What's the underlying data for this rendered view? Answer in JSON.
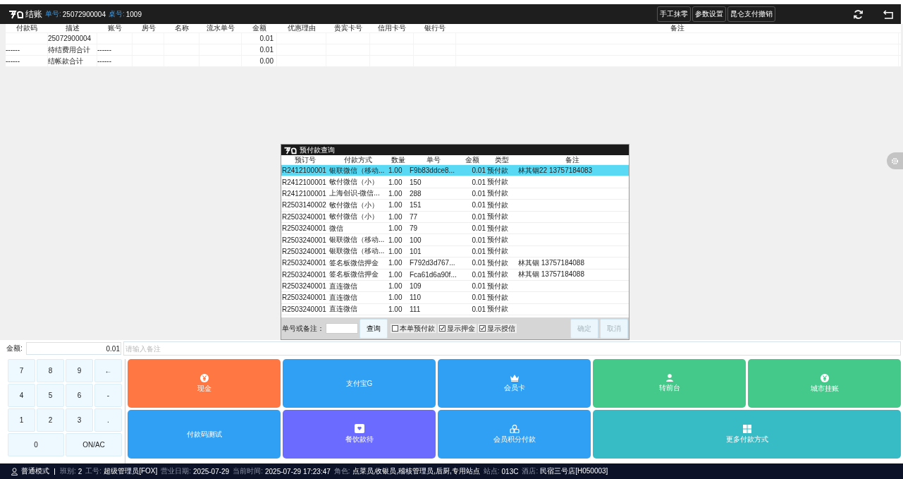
{
  "header": {
    "title": "结账",
    "order_label": "单号:",
    "order_no": "25072900004",
    "table_label": "桌号:",
    "table_no": "1009",
    "buttons": [
      "手工抹零",
      "参数设置",
      "昆仑支付撤销"
    ]
  },
  "bill_table": {
    "columns": [
      "付款码",
      "描述",
      "账号",
      "房号",
      "名称",
      "流水单号",
      "金额",
      "优惠理由",
      "贵宾卡号",
      "信用卡号",
      "银行号",
      "备注"
    ],
    "rows": [
      {
        "description": "25072900004",
        "amount": "0.01"
      },
      {
        "payment_code": "------",
        "description": "待结费用合计",
        "account": "------",
        "amount": "0.01"
      },
      {
        "payment_code": "------",
        "description": "结帐款合计",
        "account": "------",
        "amount": "0.00"
      }
    ]
  },
  "dialog": {
    "title": "预付款查询",
    "columns": [
      "预订号",
      "付款方式",
      "数量",
      "单号",
      "金额",
      "类型",
      "备注"
    ],
    "rows": [
      {
        "cells": [
          "R2412100001",
          "银联微信（移动...",
          "1.00",
          "F9b83ddce8...",
          "0.01",
          "预付款",
          "林其铟22 13757184083"
        ],
        "selected": true
      },
      {
        "cells": [
          "R2412100001",
          "敏付微信（小）",
          "1.00",
          "150",
          "0.01",
          "预付款"
        ],
        "selected": false
      },
      {
        "cells": [
          "R2412100001",
          "上海创识-微信...",
          "1.00",
          "288",
          "0.01",
          "预付款"
        ],
        "selected": false
      },
      {
        "cells": [
          "R2503140002",
          "敏付微信（小）",
          "1.00",
          "151",
          "0.01",
          "预付款"
        ],
        "selected": false
      },
      {
        "cells": [
          "R2503240001",
          "敏付微信（小）",
          "1.00",
          "77",
          "0.01",
          "预付款"
        ],
        "selected": false
      },
      {
        "cells": [
          "R2503240001",
          "微信",
          "1.00",
          "79",
          "0.01",
          "预付款"
        ],
        "selected": false
      },
      {
        "cells": [
          "R2503240001",
          "银联微信（移动...",
          "1.00",
          "100",
          "0.01",
          "预付款"
        ],
        "selected": false
      },
      {
        "cells": [
          "R2503240001",
          "银联微信（移动...",
          "1.00",
          "101",
          "0.01",
          "预付款"
        ],
        "selected": false
      },
      {
        "cells": [
          "R2503240001",
          "签名板微信押金",
          "1.00",
          "F792d3d767...",
          "0.01",
          "预付款",
          "林其铟 13757184088"
        ],
        "selected": false
      },
      {
        "cells": [
          "R2503240001",
          "签名板微信押金",
          "1.00",
          "Fca61d6a90f...",
          "0.01",
          "预付款",
          "林其铟 13757184088"
        ],
        "selected": false
      },
      {
        "cells": [
          "R2503240001",
          "直连微信",
          "1.00",
          "109",
          "0.01",
          "预付款"
        ],
        "selected": false
      },
      {
        "cells": [
          "R2503240001",
          "直连微信",
          "1.00",
          "110",
          "0.01",
          "预付款"
        ],
        "selected": false
      },
      {
        "cells": [
          "R2503240001",
          "直连微信",
          "1.00",
          "111",
          "0.01",
          "预付款"
        ],
        "selected": false
      }
    ],
    "search_label": "单号或备注：",
    "search_button": "查询",
    "checkboxes": [
      {
        "label": "本单预付款",
        "checked": false
      },
      {
        "label": "显示押金",
        "checked": true
      },
      {
        "label": "显示授信",
        "checked": true
      }
    ],
    "actions": [
      {
        "label": "确定",
        "disabled": true
      },
      {
        "label": "取消",
        "disabled": true
      }
    ]
  },
  "amount": {
    "label": "金额:",
    "value": "0.01"
  },
  "remark": {
    "placeholder": "请输入备注"
  },
  "keypad": [
    {
      "label": "7",
      "wide": false
    },
    {
      "label": "8",
      "wide": false
    },
    {
      "label": "9",
      "wide": false
    },
    {
      "label": "←",
      "wide": false
    },
    {
      "label": "4",
      "wide": false
    },
    {
      "label": "5",
      "wide": false
    },
    {
      "label": "6",
      "wide": false
    },
    {
      "label": "-",
      "wide": false
    },
    {
      "label": "1",
      "wide": false
    },
    {
      "label": "2",
      "wide": false
    },
    {
      "label": "3",
      "wide": false
    },
    {
      "label": ".",
      "wide": false
    },
    {
      "label": "0",
      "wide": true
    },
    {
      "label": "ON/AC",
      "wide": true
    }
  ],
  "payment_methods": [
    {
      "label": "现金",
      "kind": "yen",
      "color": "#ff7743",
      "wide": false
    },
    {
      "label": "支付宝G",
      "kind": "plain",
      "color": "#30a0f5",
      "wide": false
    },
    {
      "label": "会员卡",
      "kind": "crown",
      "color": "#30a0f5",
      "wide": false
    },
    {
      "label": "转前台",
      "kind": "person",
      "color": "#44c98a",
      "wide": false
    },
    {
      "label": "城市挂账",
      "kind": "yen",
      "color": "#44c98a",
      "wide": false
    },
    {
      "label": "付款码测试",
      "kind": "plain",
      "color": "#30a0f5",
      "wide": false
    },
    {
      "label": "餐饮款待",
      "kind": "envelope",
      "color": "#6b6cff",
      "wide": false
    },
    {
      "label": "会员积分付款",
      "kind": "coins",
      "color": "#30a0f5",
      "wide": false
    },
    {
      "label": "更多付款方式",
      "kind": "grid",
      "color": "#37bbc5",
      "wide": true
    }
  ],
  "status_bar": {
    "mode": "普通模式",
    "fields": [
      {
        "label": "班别:",
        "value": "2"
      },
      {
        "label": "工号:",
        "value": "超级管理员[FOX]"
      },
      {
        "label": "营业日期:",
        "value": "2025-07-29"
      },
      {
        "label": "当前时间:",
        "value": "2025-07-29 17:23:47"
      },
      {
        "label": "角色:",
        "value": "点菜员,收银员,稽核管理员,后厨,专用站点"
      },
      {
        "label": "站点:",
        "value": "013C"
      },
      {
        "label": "酒店:",
        "value": "民宿三号店[H050003]"
      }
    ]
  }
}
